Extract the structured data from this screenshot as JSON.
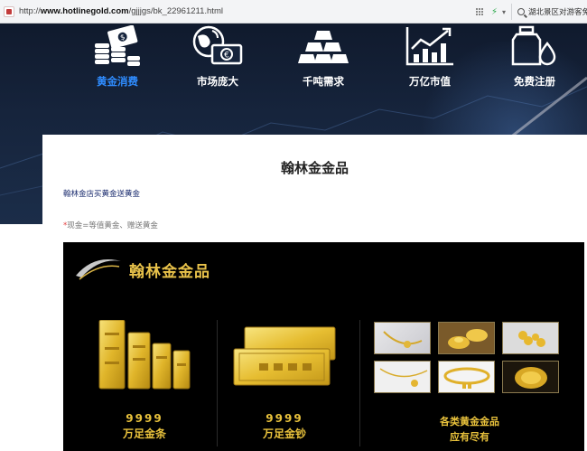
{
  "browser": {
    "url_prefix": "http://",
    "url_domain": "www.hotlinegold.com",
    "url_path": "/gjjjgs/bk_22961211.html",
    "search_text": "湖北景区对游客免票"
  },
  "hero": {
    "features": [
      {
        "label": "黄金消费",
        "icon": "coins-money-icon",
        "active": true
      },
      {
        "label": "市场庞大",
        "icon": "globe-euro-icon",
        "active": false
      },
      {
        "label": "千吨需求",
        "icon": "gold-bars-icon",
        "active": false
      },
      {
        "label": "万亿市值",
        "icon": "growth-chart-icon",
        "active": false
      },
      {
        "label": "免费注册",
        "icon": "bottle-drop-icon",
        "active": false
      }
    ]
  },
  "article": {
    "title": "翰林金金品",
    "line1": "翰林金店买黄金送黄金",
    "line2_star": "*",
    "line2": "现金=等值黄金、赠送黄金"
  },
  "banner": {
    "brand": "翰林金金品",
    "products": [
      {
        "nums": "9999",
        "name": "万足金条"
      },
      {
        "nums": "9999",
        "name": "万足金钞"
      },
      {
        "nums": "各类黄金金品",
        "name": "应有尽有"
      }
    ]
  },
  "colors": {
    "active_blue": "#2f8cff",
    "gold": "#e9c23c",
    "hero_bg": "#16243c"
  }
}
